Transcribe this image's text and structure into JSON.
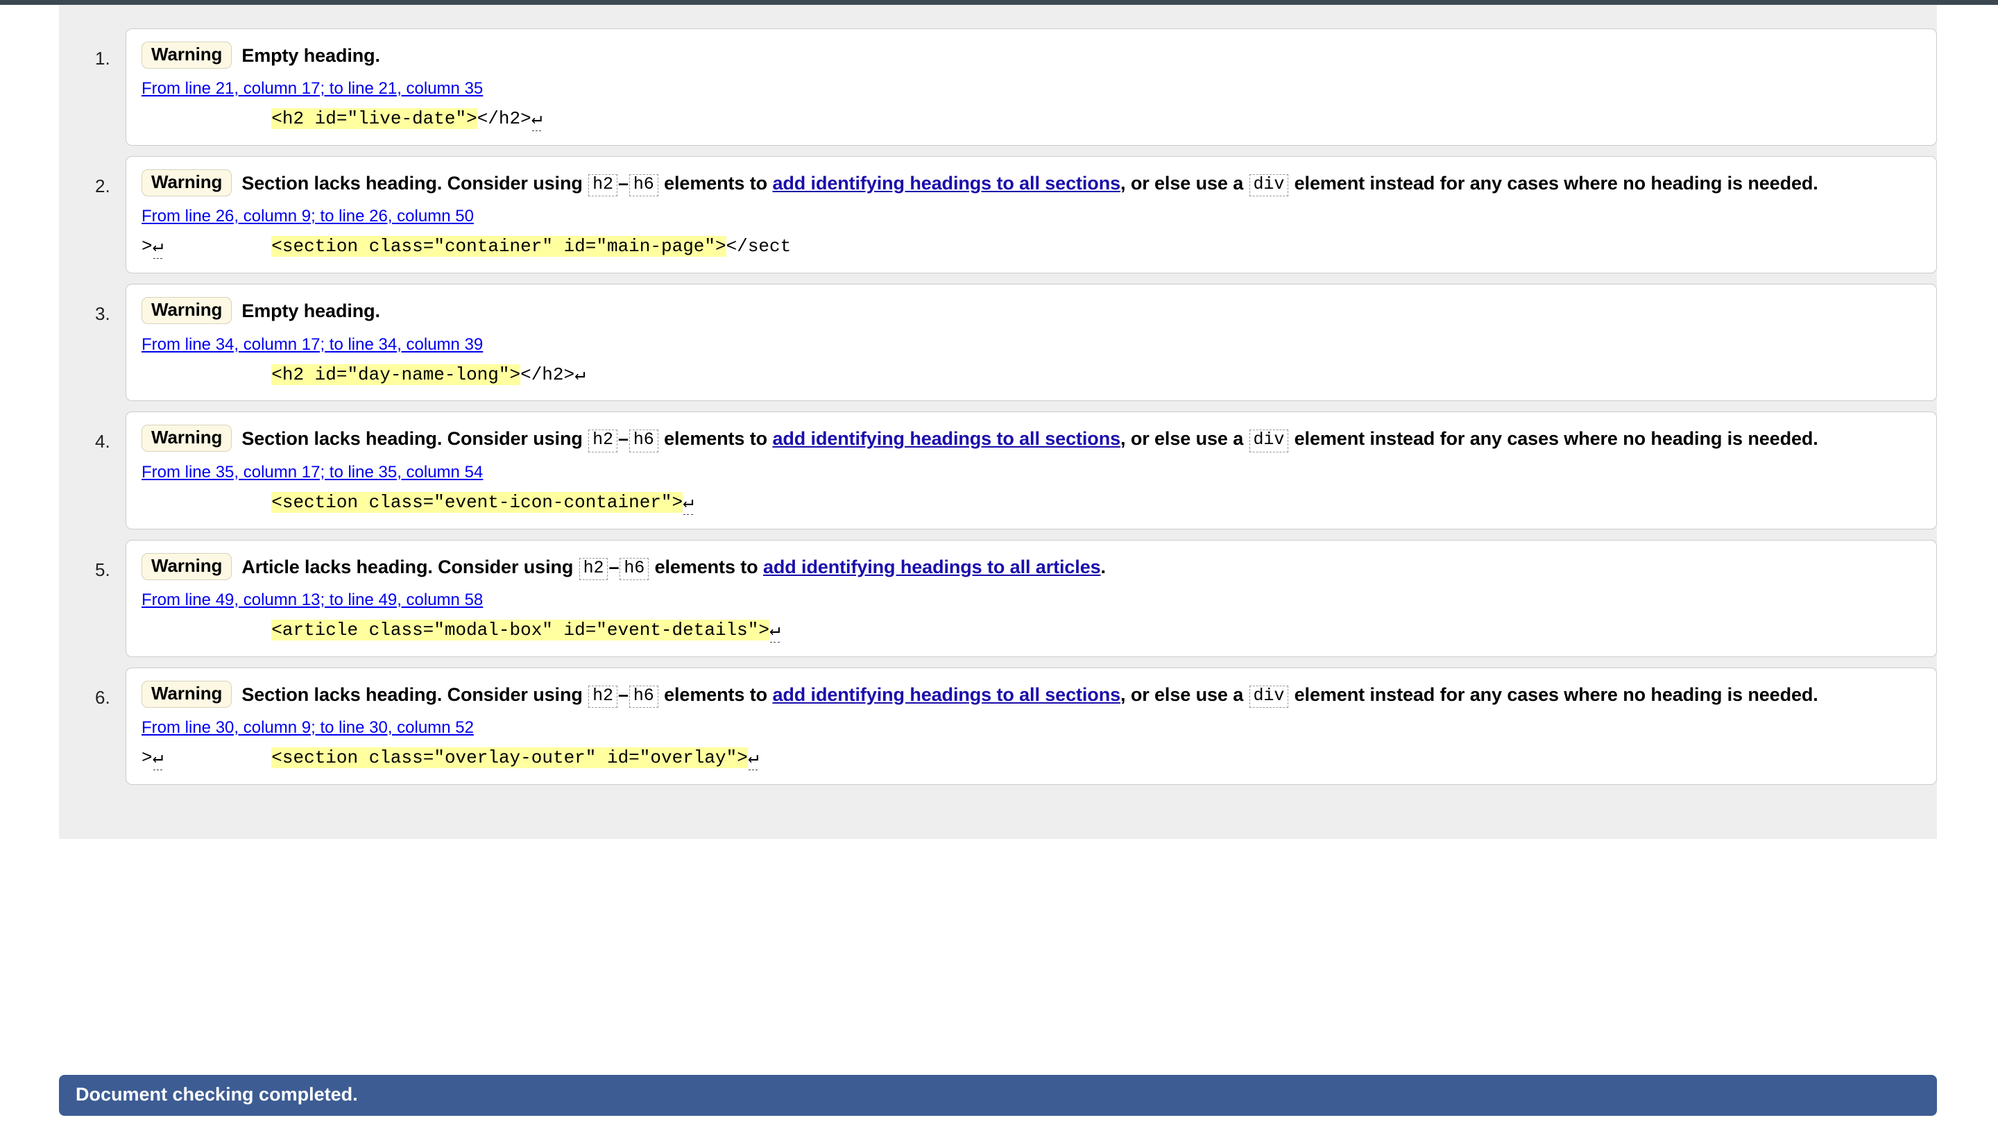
{
  "page": {
    "background": "#eeeeee",
    "card_background": "#ffffff",
    "warning_badge_color": "#fcf8e3",
    "link_color": "#0000ee",
    "highlight_color": "#ffffa0",
    "status_bar_color": "#3d5c93"
  },
  "messages": [
    {
      "index": "1.",
      "badge": "Warning",
      "text_parts": [
        {
          "kind": "text",
          "value": "Empty heading."
        }
      ],
      "location": "From line 21, column 17; to line 21, column 35",
      "extract": {
        "before": "            ",
        "highlight": "<h2 id=\"live-date\">",
        "after": "</h2>",
        "newline_after": true,
        "newline_before": false
      }
    },
    {
      "index": "2.",
      "badge": "Warning",
      "text_parts": [
        {
          "kind": "text",
          "value": "Section lacks heading. Consider using "
        },
        {
          "kind": "code",
          "value": "h2"
        },
        {
          "kind": "text",
          "value": "–"
        },
        {
          "kind": "code",
          "value": "h6"
        },
        {
          "kind": "text",
          "value": " elements to "
        },
        {
          "kind": "link",
          "value": "add identifying headings to all sections"
        },
        {
          "kind": "text",
          "value": ", or else use a "
        },
        {
          "kind": "code",
          "value": "div"
        },
        {
          "kind": "text",
          "value": " element instead for any cases where no heading is needed."
        }
      ],
      "location": "From line 26, column 9; to line 26, column 50",
      "extract": {
        "before": ">",
        "highlight": "<section class=\"container\" id=\"main-page\">",
        "after": "</sect",
        "newline_after": false,
        "newline_before": true
      }
    },
    {
      "index": "3.",
      "badge": "Warning",
      "text_parts": [
        {
          "kind": "text",
          "value": "Empty heading."
        }
      ],
      "location": "From line 34, column 17; to line 34, column 39",
      "extract": {
        "before": "            ",
        "highlight": "<h2 id=\"day-name-long\">",
        "after": "</h2>",
        "newline_after": true,
        "newline_before": false
      }
    },
    {
      "index": "4.",
      "badge": "Warning",
      "text_parts": [
        {
          "kind": "text",
          "value": "Section lacks heading. Consider using "
        },
        {
          "kind": "code",
          "value": "h2"
        },
        {
          "kind": "text",
          "value": "–"
        },
        {
          "kind": "code",
          "value": "h6"
        },
        {
          "kind": "text",
          "value": " elements to "
        },
        {
          "kind": "link",
          "value": "add identifying headings to all sections"
        },
        {
          "kind": "text",
          "value": ", or else use a "
        },
        {
          "kind": "code",
          "value": "div"
        },
        {
          "kind": "text",
          "value": " element instead for any cases where no heading is needed."
        }
      ],
      "location": "From line 35, column 17; to line 35, column 54",
      "extract": {
        "before": "            ",
        "highlight": "<section class=\"event-icon-container\">",
        "after": "",
        "newline_after": true,
        "newline_before": false
      }
    },
    {
      "index": "5.",
      "badge": "Warning",
      "text_parts": [
        {
          "kind": "text",
          "value": "Article lacks heading. Consider using "
        },
        {
          "kind": "code",
          "value": "h2"
        },
        {
          "kind": "text",
          "value": "–"
        },
        {
          "kind": "code",
          "value": "h6"
        },
        {
          "kind": "text",
          "value": " elements to "
        },
        {
          "kind": "link",
          "value": "add identifying headings to all articles"
        },
        {
          "kind": "text",
          "value": "."
        }
      ],
      "location": "From line 49, column 13; to line 49, column 58",
      "extract": {
        "before": "            ",
        "highlight": "<article class=\"modal-box\" id=\"event-details\">",
        "after": "",
        "newline_after": true,
        "newline_before": false
      }
    },
    {
      "index": "6.",
      "badge": "Warning",
      "text_parts": [
        {
          "kind": "text",
          "value": "Section lacks heading. Consider using "
        },
        {
          "kind": "code",
          "value": "h2"
        },
        {
          "kind": "text",
          "value": "–"
        },
        {
          "kind": "code",
          "value": "h6"
        },
        {
          "kind": "text",
          "value": " elements to "
        },
        {
          "kind": "link",
          "value": "add identifying headings to all sections"
        },
        {
          "kind": "text",
          "value": ", or else use a "
        },
        {
          "kind": "code",
          "value": "div"
        },
        {
          "kind": "text",
          "value": " element instead for any cases where no heading is needed."
        }
      ],
      "location": "From line 30, column 9; to line 30, column 52",
      "extract": {
        "before": ">",
        "highlight": "<section class=\"overlay-outer\" id=\"overlay\">",
        "after": "",
        "newline_after": true,
        "newline_before": true
      }
    }
  ],
  "status_bar": {
    "text": "Document checking completed."
  }
}
